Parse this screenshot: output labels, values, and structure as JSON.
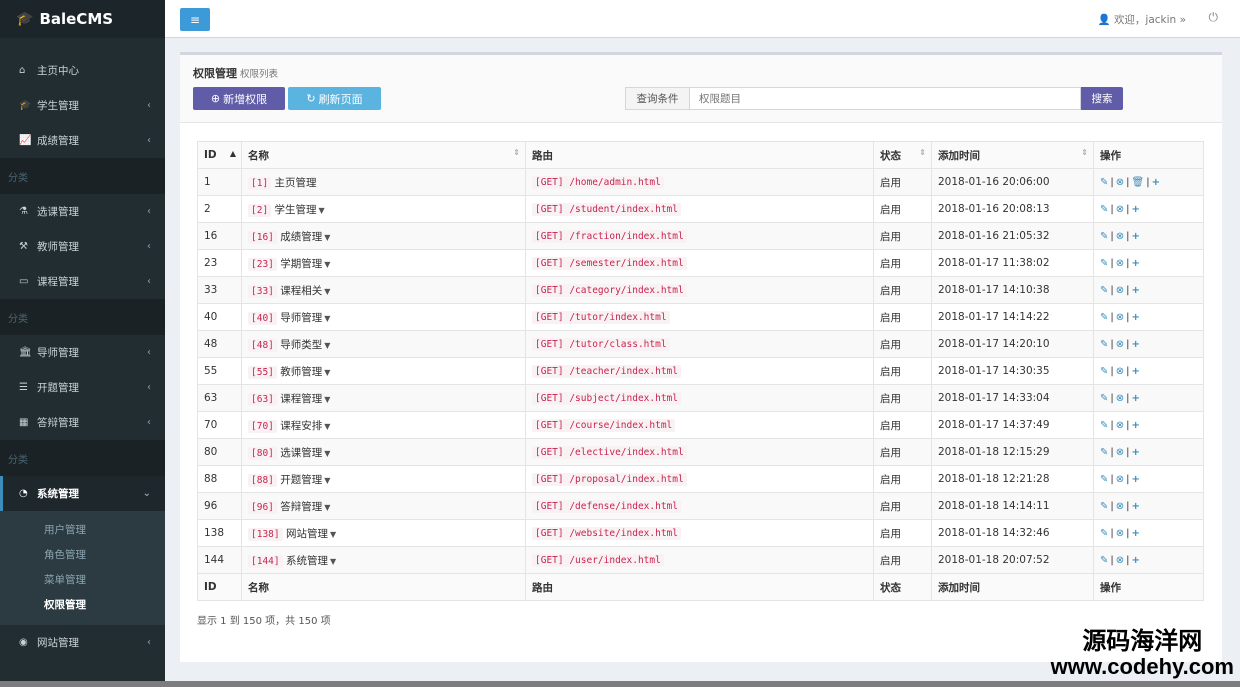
{
  "brand": "BaleCMS",
  "sidebar": {
    "home": "主页中心",
    "student": "学生管理",
    "score": "成绩管理",
    "section1": "分类",
    "elective": "选课管理",
    "teacher": "教师管理",
    "course": "课程管理",
    "section2": "分类",
    "tutor": "导师管理",
    "proposal": "开题管理",
    "defense": "答辩管理",
    "section3": "分类",
    "system": "系统管理",
    "sub_items": [
      "用户管理",
      "角色管理",
      "菜单管理",
      "权限管理"
    ],
    "website": "网站管理"
  },
  "header": {
    "user": "欢迎，jackin"
  },
  "page": {
    "title": "权限管理",
    "subtitle": "权限列表",
    "add_label": "新增权限",
    "refresh_label": "刷新页面",
    "query_label": "查询条件",
    "query_placeholder": "权限题目",
    "search_label": "搜索"
  },
  "table": {
    "headers": [
      "ID",
      "名称",
      "路由",
      "状态",
      "添加时间",
      "操作"
    ],
    "rows": [
      {
        "id": "1",
        "tag": "[1]",
        "name": "主页管理",
        "caret": false,
        "route": "[GET] /home/admin.html",
        "status": "启用",
        "time": "2018-01-16 20:06:00",
        "delete": true
      },
      {
        "id": "2",
        "tag": "[2]",
        "name": "学生管理",
        "caret": true,
        "route": "[GET] /student/index.html",
        "status": "启用",
        "time": "2018-01-16 20:08:13",
        "delete": false
      },
      {
        "id": "16",
        "tag": "[16]",
        "name": "成绩管理",
        "caret": true,
        "route": "[GET] /fraction/index.html",
        "status": "启用",
        "time": "2018-01-16 21:05:32",
        "delete": false
      },
      {
        "id": "23",
        "tag": "[23]",
        "name": "学期管理",
        "caret": true,
        "route": "[GET] /semester/index.html",
        "status": "启用",
        "time": "2018-01-17 11:38:02",
        "delete": false
      },
      {
        "id": "33",
        "tag": "[33]",
        "name": "课程相关",
        "caret": true,
        "route": "[GET] /category/index.html",
        "status": "启用",
        "time": "2018-01-17 14:10:38",
        "delete": false
      },
      {
        "id": "40",
        "tag": "[40]",
        "name": "导师管理",
        "caret": true,
        "route": "[GET] /tutor/index.html",
        "status": "启用",
        "time": "2018-01-17 14:14:22",
        "delete": false
      },
      {
        "id": "48",
        "tag": "[48]",
        "name": "导师类型",
        "caret": true,
        "route": "[GET] /tutor/class.html",
        "status": "启用",
        "time": "2018-01-17 14:20:10",
        "delete": false
      },
      {
        "id": "55",
        "tag": "[55]",
        "name": "教师管理",
        "caret": true,
        "route": "[GET] /teacher/index.html",
        "status": "启用",
        "time": "2018-01-17 14:30:35",
        "delete": false
      },
      {
        "id": "63",
        "tag": "[63]",
        "name": "课程管理",
        "caret": true,
        "route": "[GET] /subject/index.html",
        "status": "启用",
        "time": "2018-01-17 14:33:04",
        "delete": false
      },
      {
        "id": "70",
        "tag": "[70]",
        "name": "课程安排",
        "caret": true,
        "route": "[GET] /course/index.html",
        "status": "启用",
        "time": "2018-01-17 14:37:49",
        "delete": false
      },
      {
        "id": "80",
        "tag": "[80]",
        "name": "选课管理",
        "caret": true,
        "route": "[GET] /elective/index.html",
        "status": "启用",
        "time": "2018-01-18 12:15:29",
        "delete": false
      },
      {
        "id": "88",
        "tag": "[88]",
        "name": "开题管理",
        "caret": true,
        "route": "[GET] /proposal/index.html",
        "status": "启用",
        "time": "2018-01-18 12:21:28",
        "delete": false
      },
      {
        "id": "96",
        "tag": "[96]",
        "name": "答辩管理",
        "caret": true,
        "route": "[GET] /defense/index.html",
        "status": "启用",
        "time": "2018-01-18 14:14:11",
        "delete": false
      },
      {
        "id": "138",
        "tag": "[138]",
        "name": "网站管理",
        "caret": true,
        "route": "[GET] /website/index.html",
        "status": "启用",
        "time": "2018-01-18 14:32:46",
        "delete": false
      },
      {
        "id": "144",
        "tag": "[144]",
        "name": "系统管理",
        "caret": true,
        "route": "[GET] /user/index.html",
        "status": "启用",
        "time": "2018-01-18 20:07:52",
        "delete": false
      }
    ],
    "footer_headers": [
      "ID",
      "名称",
      "路由",
      "状态",
      "添加时间",
      "操作"
    ]
  },
  "pagination_info": "显示 1 到 150 项，共 150 项",
  "watermark": {
    "line1": "源码海洋网",
    "line2": "www.codehy.com"
  },
  "colors": {
    "sidebar_bg": "#222d32",
    "primary_purple": "#605ca8",
    "info_blue": "#5bb3e0",
    "code_red": "#c7254e",
    "link_blue": "#3c8dbc"
  }
}
